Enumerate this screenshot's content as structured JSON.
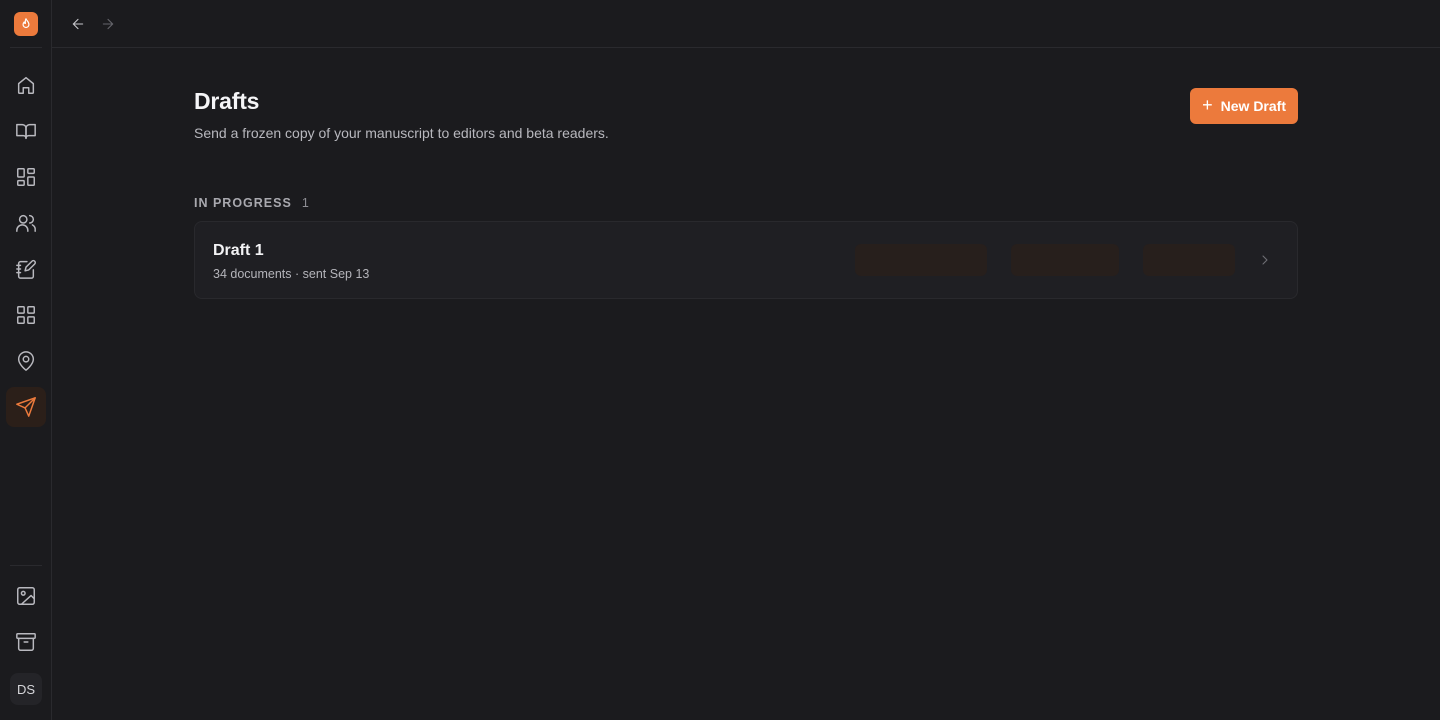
{
  "colors": {
    "accent": "#ec7a3c",
    "background": "#1b1b1e",
    "card": "#1f1f23"
  },
  "sidebar": {
    "items": [
      {
        "icon": "home-icon",
        "active": false
      },
      {
        "icon": "book-open-icon",
        "active": false
      },
      {
        "icon": "layout-dashboard-icon",
        "active": false
      },
      {
        "icon": "users-icon",
        "active": false
      },
      {
        "icon": "notebook-pen-icon",
        "active": false
      },
      {
        "icon": "grid-icon",
        "active": false
      },
      {
        "icon": "map-pin-icon",
        "active": false
      },
      {
        "icon": "send-icon",
        "active": true
      }
    ],
    "bottom_items": [
      {
        "icon": "image-icon"
      },
      {
        "icon": "archive-icon"
      }
    ],
    "avatar_initials": "DS"
  },
  "topbar": {
    "back_icon": "arrow-left-icon",
    "forward_icon": "arrow-right-icon"
  },
  "page": {
    "title": "Drafts",
    "subtitle": "Send a frozen copy of your manuscript to editors and beta readers.",
    "new_button": {
      "icon": "plus",
      "label": "New Draft"
    }
  },
  "sections": [
    {
      "label": "IN PROGRESS",
      "count": "1",
      "drafts": [
        {
          "name": "Draft 1",
          "meta": "34 documents · sent Sep 13"
        }
      ]
    }
  ]
}
